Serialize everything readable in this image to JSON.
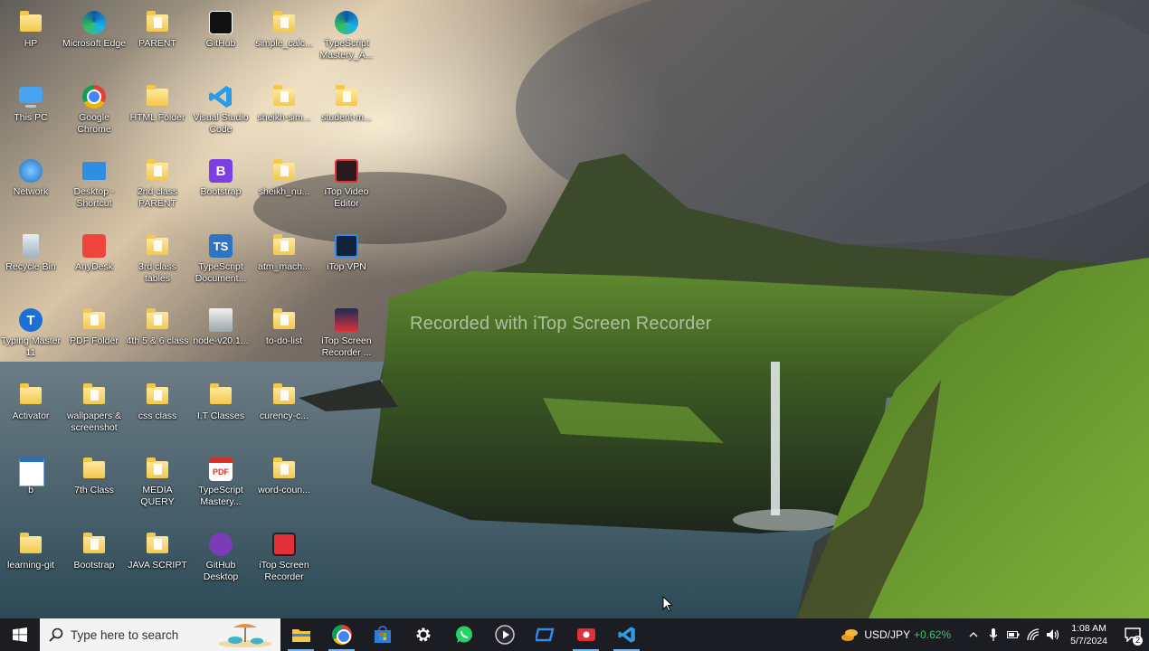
{
  "watermark": "Recorded with iTop Screen Recorder",
  "desktop_icons": [
    {
      "label": "HP",
      "icon": "user-folder-icon"
    },
    {
      "label": "Microsoft Edge",
      "icon": "edge-icon"
    },
    {
      "label": "PARENT",
      "icon": "chrome-shortcut-icon"
    },
    {
      "label": "GitHub",
      "icon": "github-icon"
    },
    {
      "label": "simple_calc...",
      "icon": "folder-icon"
    },
    {
      "label": "TypeScript Mastery_A...",
      "icon": "edge-icon"
    },
    {
      "label": "This PC",
      "icon": "computer-icon"
    },
    {
      "label": "Google Chrome",
      "icon": "chrome-icon"
    },
    {
      "label": "HTML Folder",
      "icon": "folder-icon"
    },
    {
      "label": "Visual Studio Code",
      "icon": "vscode-icon"
    },
    {
      "label": "sheikh-sim...",
      "icon": "folder-icon"
    },
    {
      "label": "student-m...",
      "icon": "folder-icon"
    },
    {
      "label": "Network",
      "icon": "network-icon"
    },
    {
      "label": "Desktop - Shortcut",
      "icon": "desktop-icon"
    },
    {
      "label": "2nd class PARENT",
      "icon": "chrome-shortcut-icon"
    },
    {
      "label": "Bootstrap",
      "icon": "bootstrap-icon"
    },
    {
      "label": "sheikh_nu...",
      "icon": "folder-icon"
    },
    {
      "label": "iTop Video Editor",
      "icon": "itop-video-editor-icon"
    },
    {
      "label": "Recycle Bin",
      "icon": "recycle-bin-icon"
    },
    {
      "label": "AnyDesk",
      "icon": "anydesk-icon"
    },
    {
      "label": "3rd class tables",
      "icon": "chrome-shortcut-icon"
    },
    {
      "label": "TypeScript Document...",
      "icon": "typescript-icon"
    },
    {
      "label": "atm_mach...",
      "icon": "folder-icon"
    },
    {
      "label": "iTop VPN",
      "icon": "itop-vpn-icon"
    },
    {
      "label": "Typing Master 11",
      "icon": "typing-master-icon"
    },
    {
      "label": "PDF Folder",
      "icon": "folder-icon"
    },
    {
      "label": "4th 5 & 6 class",
      "icon": "chrome-shortcut-icon"
    },
    {
      "label": "node-v20.1...",
      "icon": "installer-icon"
    },
    {
      "label": "to-do-list",
      "icon": "folder-icon"
    },
    {
      "label": "iTop Screen Recorder ...",
      "icon": "itop-screen-recorder-icon"
    },
    {
      "label": "Activator",
      "icon": "folder-icon"
    },
    {
      "label": "wallpapers & screenshot",
      "icon": "folder-icon"
    },
    {
      "label": "css class",
      "icon": "chrome-shortcut-icon"
    },
    {
      "label": "I.T Classes",
      "icon": "folder-icon"
    },
    {
      "label": "curency-c...",
      "icon": "folder-icon"
    },
    {
      "label": "b",
      "icon": "notepad-icon"
    },
    {
      "label": "7th Class",
      "icon": "folder-icon"
    },
    {
      "label": "MEDIA QUERY",
      "icon": "chrome-shortcut-icon"
    },
    {
      "label": "TypeScript Mastery...",
      "icon": "pdf-icon"
    },
    {
      "label": "word-coun...",
      "icon": "folder-icon"
    },
    {
      "label": "learning-git",
      "icon": "folder-icon"
    },
    {
      "label": "Bootstrap",
      "icon": "chrome-shortcut-icon"
    },
    {
      "label": "JAVA SCRIPT",
      "icon": "chrome-shortcut-icon"
    },
    {
      "label": "GitHub Desktop",
      "icon": "github-desktop-icon"
    },
    {
      "label": "iTop Screen Recorder",
      "icon": "itop-screen-recorder-icon"
    }
  ],
  "taskbar": {
    "search_placeholder": "Type here to search",
    "apps": [
      {
        "name": "File Explorer",
        "icon": "file-explorer-icon"
      },
      {
        "name": "Google Chrome",
        "icon": "chrome-icon"
      },
      {
        "name": "Microsoft Store",
        "icon": "store-icon"
      },
      {
        "name": "Settings",
        "icon": "gear-icon"
      },
      {
        "name": "WhatsApp",
        "icon": "whatsapp-icon"
      },
      {
        "name": "Media Player",
        "icon": "media-player-icon"
      },
      {
        "name": "iTop VPN",
        "icon": "itop-vpn-icon"
      },
      {
        "name": "iTop Screen Recorder",
        "icon": "itop-screen-recorder-icon"
      },
      {
        "name": "Visual Studio Code",
        "icon": "vscode-icon"
      }
    ],
    "ticker": {
      "symbol": "USD/JPY",
      "change": "+0.62%"
    },
    "clock": {
      "time": "1:08 AM",
      "date": "5/7/2024"
    },
    "notification_count": "2"
  }
}
